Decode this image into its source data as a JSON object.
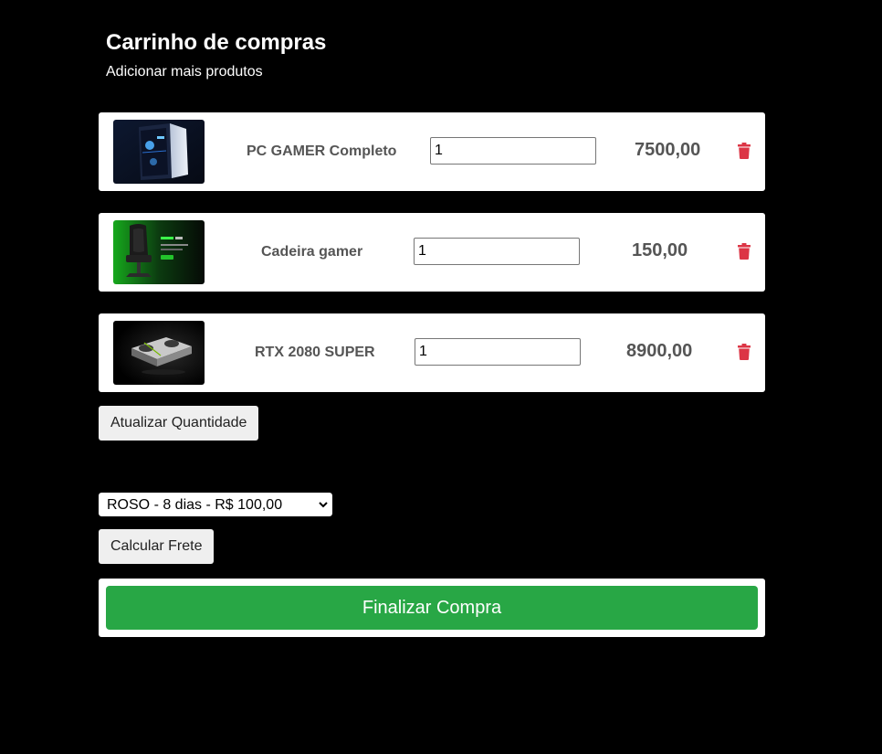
{
  "header": {
    "title": "Carrinho de compras",
    "add_more_link": "Adicionar mais produtos"
  },
  "cart": {
    "items": [
      {
        "name": "PC GAMER Completo",
        "quantity": "1",
        "price": "7500,00",
        "image": "gaming-pc-image"
      },
      {
        "name": "Cadeira gamer",
        "quantity": "1",
        "price": "150,00",
        "image": "gaming-chair-image"
      },
      {
        "name": "RTX 2080 SUPER",
        "quantity": "1",
        "price": "8900,00",
        "image": "graphics-card-image"
      }
    ]
  },
  "actions": {
    "update_quantity_label": "Atualizar Quantidade",
    "shipping_selected": "ROSO - 8 dias - R$ 100,00",
    "calculate_shipping_label": "Calcular Frete",
    "checkout_label": "Finalizar Compra"
  },
  "colors": {
    "background": "#000000",
    "card": "#ffffff",
    "trash_icon": "#dc3545",
    "checkout": "#28a745"
  }
}
